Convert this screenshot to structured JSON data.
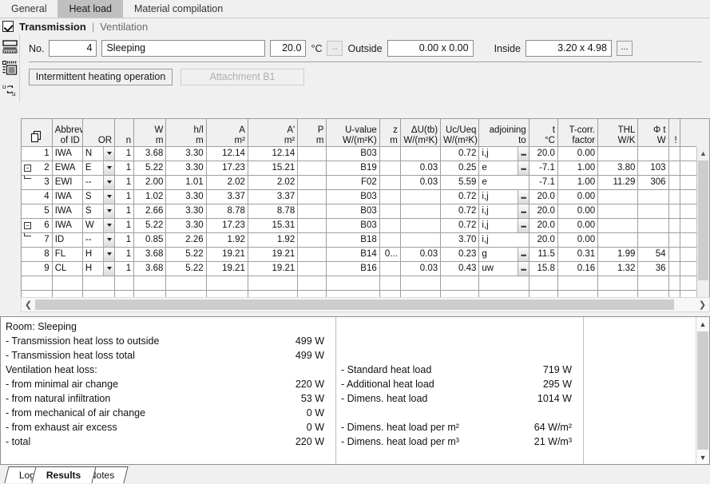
{
  "top_tabs": [
    {
      "label": "General",
      "active": false
    },
    {
      "label": "Heat load",
      "active": true
    },
    {
      "label": "Material compilation",
      "active": false
    }
  ],
  "section": {
    "checked": true,
    "main": "Transmission",
    "separator": "|",
    "alt": "Ventilation"
  },
  "rail_icons": [
    "table-rows-icon",
    "list-detail-icon",
    "swap-u-values-icon"
  ],
  "form": {
    "no_label": "No.",
    "no_value": "4",
    "room_name": "Sleeping",
    "temperature": "20.0",
    "temp_unit": "°C",
    "temp_picker": "..",
    "outside_label": "Outside",
    "outside_value": "0.00 x 0.00",
    "inside_label": "Inside",
    "inside_value": "3.20 x 4.98",
    "inside_picker": "...",
    "btn_intermittent": "Intermittent heating operation",
    "btn_attachment": "Attachment B1"
  },
  "grid": {
    "headers": [
      {
        "l1": "",
        "l2": "",
        "name": "copy-column",
        "align": "center"
      },
      {
        "l1": "Abbrev",
        "l2": "of ID",
        "name": "abbrev-of-id",
        "align": "left"
      },
      {
        "l1": "OR",
        "l2": "",
        "name": "orientation",
        "align": "left"
      },
      {
        "l1": "n",
        "l2": "",
        "name": "count",
        "align": "right"
      },
      {
        "l1": "W",
        "l2": "m",
        "name": "width",
        "align": "right"
      },
      {
        "l1": "h/l",
        "l2": "m",
        "name": "height-length",
        "align": "right"
      },
      {
        "l1": "A",
        "l2": "m²",
        "name": "area",
        "align": "right"
      },
      {
        "l1": "A'",
        "l2": "m²",
        "name": "area-net",
        "align": "right"
      },
      {
        "l1": "P",
        "l2": "m",
        "name": "perimeter",
        "align": "right"
      },
      {
        "l1": "U-value",
        "l2": "W/(m²K)",
        "name": "u-value",
        "align": "right"
      },
      {
        "l1": "z",
        "l2": "m",
        "name": "z-depth",
        "align": "right"
      },
      {
        "l1": "ΔU(tb)",
        "l2": "W/(m²K)",
        "name": "delta-u-thermal-bridge",
        "align": "right"
      },
      {
        "l1": "Uc/Ueq",
        "l2": "W/(m²K)",
        "name": "uc-ueq",
        "align": "right"
      },
      {
        "l1": "adjoining",
        "l2": "to",
        "name": "adjoining-to",
        "align": "left"
      },
      {
        "l1": "t",
        "l2": "°C",
        "name": "temperature",
        "align": "right"
      },
      {
        "l1": "T-corr.",
        "l2": "factor",
        "name": "t-correction-factor",
        "align": "right"
      },
      {
        "l1": "THL",
        "l2": "W/K",
        "name": "thl",
        "align": "right"
      },
      {
        "l1": "Φ t",
        "l2": "W",
        "name": "phi-t",
        "align": "right"
      },
      {
        "l1": "!",
        "l2": "",
        "name": "warning",
        "align": "left"
      },
      {
        "l1": "",
        "l2": "",
        "name": "spare",
        "align": "left"
      }
    ],
    "sort_glyph": "≓",
    "rows": [
      {
        "no": "1",
        "tree": "",
        "abbrev": "IWA",
        "or": "N",
        "n": "1",
        "w": "3.68",
        "hl": "3.30",
        "a": "12.14",
        "a2": "12.14",
        "p": "",
        "uval": "B03",
        "z": "",
        "dutb": "",
        "ucueq": "0.72",
        "adj": "i,j",
        "adj_btn": true,
        "t": "20.0",
        "tcorr": "0.00",
        "thl": "",
        "phit": "",
        "warn": ""
      },
      {
        "no": "2",
        "tree": "parent",
        "abbrev": "EWA",
        "or": "E",
        "n": "1",
        "w": "5.22",
        "hl": "3.30",
        "a": "17.23",
        "a2": "15.21",
        "p": "",
        "uval": "B19",
        "z": "",
        "dutb": "0.03",
        "ucueq": "0.25",
        "adj": "e",
        "adj_btn": true,
        "t": "-7.1",
        "tcorr": "1.00",
        "thl": "3.80",
        "phit": "103",
        "warn": ""
      },
      {
        "no": "3",
        "tree": "child",
        "abbrev": "EWI",
        "or": "--",
        "n": "1",
        "w": "2.00",
        "hl": "1.01",
        "a": "2.02",
        "a2": "2.02",
        "p": "",
        "uval": "F02",
        "z": "",
        "dutb": "0.03",
        "ucueq": "5.59",
        "adj": "e",
        "adj_btn": false,
        "t": "-7.1",
        "tcorr": "1.00",
        "thl": "11.29",
        "phit": "306",
        "warn": ""
      },
      {
        "no": "4",
        "tree": "",
        "abbrev": "IWA",
        "or": "S",
        "n": "1",
        "w": "1.02",
        "hl": "3.30",
        "a": "3.37",
        "a2": "3.37",
        "p": "",
        "uval": "B03",
        "z": "",
        "dutb": "",
        "ucueq": "0.72",
        "adj": "i,j",
        "adj_btn": true,
        "t": "20.0",
        "tcorr": "0.00",
        "thl": "",
        "phit": "",
        "warn": ""
      },
      {
        "no": "5",
        "tree": "",
        "abbrev": "IWA",
        "or": "S",
        "n": "1",
        "w": "2.66",
        "hl": "3.30",
        "a": "8.78",
        "a2": "8.78",
        "p": "",
        "uval": "B03",
        "z": "",
        "dutb": "",
        "ucueq": "0.72",
        "adj": "i,j",
        "adj_btn": true,
        "t": "20.0",
        "tcorr": "0.00",
        "thl": "",
        "phit": "",
        "warn": ""
      },
      {
        "no": "6",
        "tree": "parent",
        "abbrev": "IWA",
        "or": "W",
        "n": "1",
        "w": "5.22",
        "hl": "3.30",
        "a": "17.23",
        "a2": "15.31",
        "p": "",
        "uval": "B03",
        "z": "",
        "dutb": "",
        "ucueq": "0.72",
        "adj": "i,j",
        "adj_btn": true,
        "t": "20.0",
        "tcorr": "0.00",
        "thl": "",
        "phit": "",
        "warn": ""
      },
      {
        "no": "7",
        "tree": "child",
        "abbrev": "ID",
        "or": "--",
        "n": "1",
        "w": "0.85",
        "hl": "2.26",
        "a": "1.92",
        "a2": "1.92",
        "p": "",
        "uval": "B18",
        "z": "",
        "dutb": "",
        "ucueq": "3.70",
        "adj": "i,j",
        "adj_btn": false,
        "t": "20.0",
        "tcorr": "0.00",
        "thl": "",
        "phit": "",
        "warn": ""
      },
      {
        "no": "8",
        "tree": "",
        "abbrev": "FL",
        "or": "H",
        "n": "1",
        "w": "3.68",
        "hl": "5.22",
        "a": "19.21",
        "a2": "19.21",
        "p": "",
        "uval": "B14",
        "z": "0...",
        "dutb": "0.03",
        "ucueq": "0.23",
        "adj": "g",
        "adj_btn": true,
        "t": "11.5",
        "tcorr": "0.31",
        "thl": "1.99",
        "phit": "54",
        "warn": ""
      },
      {
        "no": "9",
        "tree": "",
        "abbrev": "CL",
        "or": "H",
        "n": "1",
        "w": "3.68",
        "hl": "5.22",
        "a": "19.21",
        "a2": "19.21",
        "p": "",
        "uval": "B16",
        "z": "",
        "dutb": "0.03",
        "ucueq": "0.43",
        "adj": "uw",
        "adj_btn": true,
        "t": "15.8",
        "tcorr": "0.16",
        "thl": "1.32",
        "phit": "36",
        "warn": ""
      }
    ]
  },
  "results": {
    "left": [
      {
        "label": "Room: Sleeping",
        "value": ""
      },
      {
        "label": "- Transmission heat loss to outside",
        "value": "499 W"
      },
      {
        "label": "- Transmission heat loss total",
        "value": "499 W"
      },
      {
        "label": "Ventilation heat loss:",
        "value": ""
      },
      {
        "label": "- from minimal air change",
        "value": "220 W"
      },
      {
        "label": "- from natural infiltration",
        "value": "53 W"
      },
      {
        "label": "- from mechanical of air change",
        "value": "0 W"
      },
      {
        "label": "- from exhaust air excess",
        "value": "0 W"
      },
      {
        "label": "- total",
        "value": "220 W"
      }
    ],
    "middle": [
      {
        "label": "- Standard heat load",
        "value": "719 W"
      },
      {
        "label": "- Additional heat load",
        "value": "295 W"
      },
      {
        "label": "- Dimens. heat load",
        "value": "1014 W"
      },
      {
        "label": "",
        "value": ""
      },
      {
        "label": "- Dimens. heat load per m²",
        "value": "64 W/m²"
      },
      {
        "label": "- Dimens. heat load per m³",
        "value": "21 W/m³"
      }
    ]
  },
  "bottom_tabs": [
    {
      "label": "Log",
      "selected": false
    },
    {
      "label": "Results",
      "selected": true
    },
    {
      "label": "Notes",
      "selected": false
    }
  ]
}
